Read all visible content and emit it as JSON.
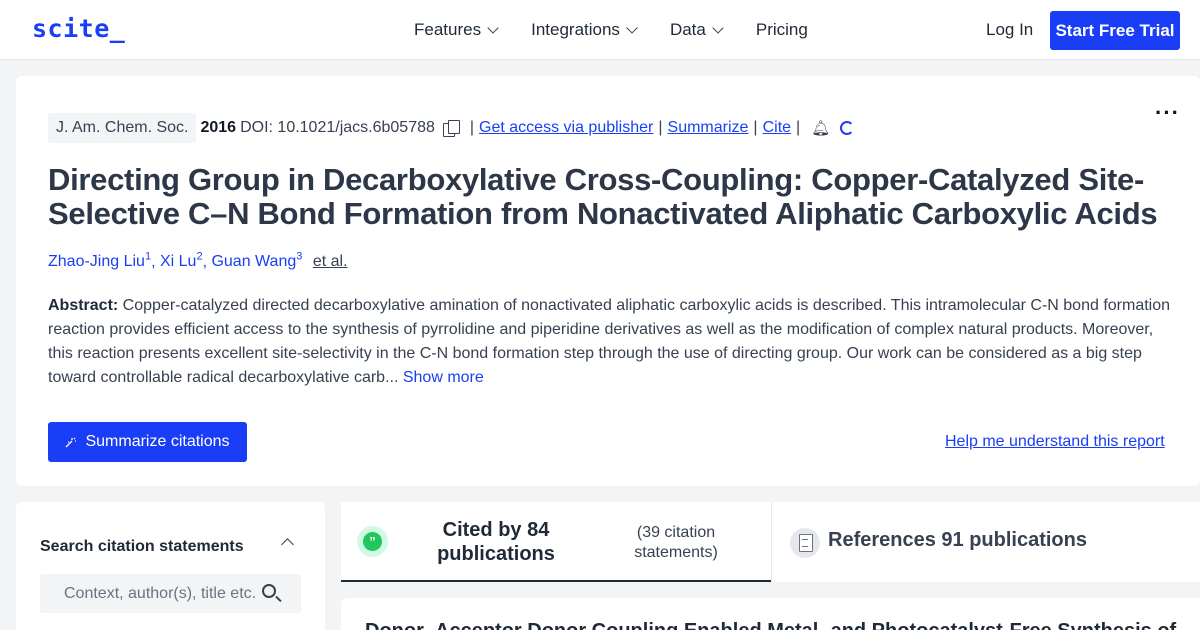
{
  "nav": {
    "logo": "scite_",
    "links": [
      {
        "label": "Features",
        "dropdown": true
      },
      {
        "label": "Integrations",
        "dropdown": true
      },
      {
        "label": "Data",
        "dropdown": true
      },
      {
        "label": "Pricing",
        "dropdown": false
      }
    ],
    "login": "Log In",
    "trial": "Start Free Trial"
  },
  "paper": {
    "journal": "J. Am. Chem. Soc.",
    "year": "2016",
    "doi": "DOI: 10.1021/jacs.6b05788",
    "links": {
      "access": "Get access via publisher",
      "summarize": "Summarize",
      "cite": "Cite"
    },
    "title": "Directing Group in Decarboxylative Cross-Coupling: Copper-Catalyzed Site-Selective C–N Bond Formation from Nonactivated Aliphatic Carboxylic Acids",
    "authors": [
      {
        "name": "Zhao-Jing Liu",
        "sup": "1"
      },
      {
        "name": "Xi Lu",
        "sup": "2"
      },
      {
        "name": "Guan Wang",
        "sup": "3"
      }
    ],
    "et_al": "et al.",
    "abstract_label": "Abstract:",
    "abstract_text": " Copper-catalyzed directed decarboxylative amination of nonactivated aliphatic carboxylic acids is described. This intramolecular C-N bond formation reaction provides efficient access to the synthesis of pyrrolidine and piperidine derivatives as well as the modification of complex natural products. Moreover, this reaction presents excellent site-selectivity in the C-N bond formation step through the use of directing group. Our work can be considered as a big step toward controllable radical decarboxylative carb...",
    "show_more": "Show more",
    "summarize_button": "Summarize citations",
    "help_link": "Help me understand this report"
  },
  "sidebar": {
    "search_title": "Search citation statements",
    "search_placeholder": "Context, author(s), title etc."
  },
  "tabs": {
    "cited_label": "Cited by 84 publications",
    "cited_statements": "(39 citation statements)",
    "references_label": "References 91 publications"
  },
  "result": {
    "title": "Donor–Acceptor Donor Coupling Enabled Metal- and Photocatalyst-Free Synthesis of"
  }
}
